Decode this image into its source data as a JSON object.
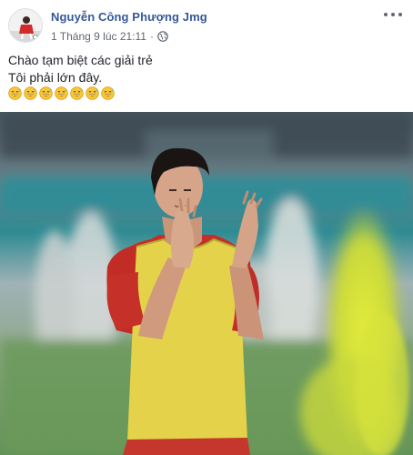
{
  "post": {
    "author": "Nguyễn Công Phượng Jmg",
    "timestamp": "1 Tháng 9 lúc 21:11",
    "meta_separator": "·",
    "privacy_icon": "globe-icon",
    "more_icon": "more-options-icon",
    "text_lines": [
      "Chào tạm biệt các giải trẻ",
      "Tôi phải lớn đây."
    ],
    "emoji_count": 7,
    "emoji_icon": "grinning-sweat-emoji-icon",
    "colors": {
      "author_link": "#365899",
      "meta_text": "#616770",
      "body_text": "#1d2129",
      "jersey_yellow": "#e6d84a",
      "shirt_red": "#c8322a",
      "grass": "#6d9a5e"
    }
  }
}
